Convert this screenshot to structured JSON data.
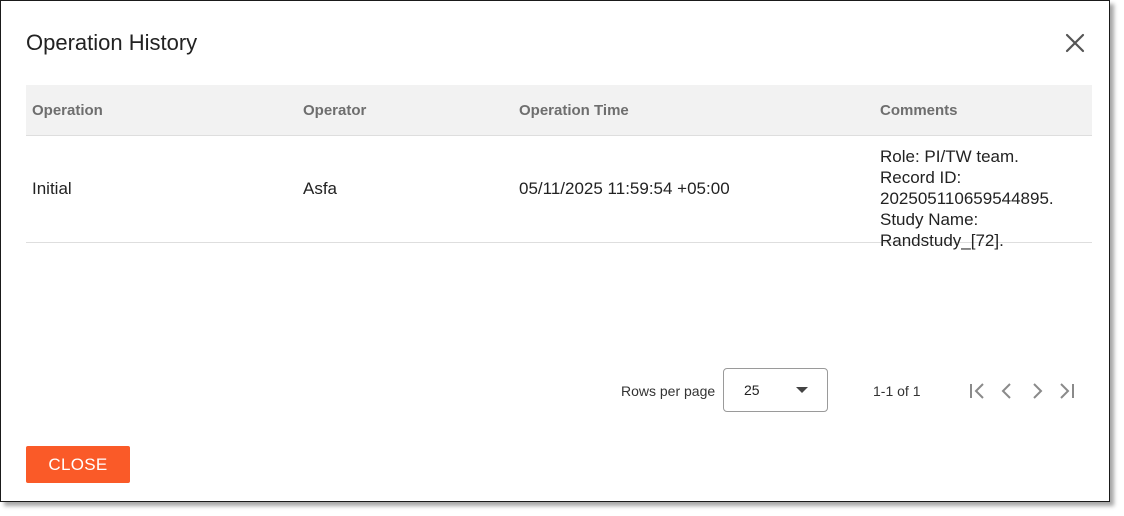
{
  "dialog": {
    "title": "Operation History",
    "close_icon": "close-icon"
  },
  "table": {
    "columns": [
      "Operation",
      "Operator",
      "Operation Time",
      "Comments"
    ],
    "rows": [
      {
        "operation": "Initial",
        "operator": "Asfa",
        "operation_time": "05/11/2025 11:59:54 +05:00",
        "comments": [
          "Role: PI/TW team.",
          "Record ID:",
          "20250511065954489​5.",
          "Study Name:",
          "Randstudy_[72]."
        ]
      }
    ]
  },
  "pagination": {
    "rows_per_page_label": "Rows per page",
    "rows_per_page_value": "25",
    "range_text": "1-1 of 1",
    "icons": [
      "first-page-icon",
      "previous-page-icon",
      "next-page-icon",
      "last-page-icon"
    ]
  },
  "footer": {
    "close_label": "CLOSE"
  },
  "colors": {
    "accent": "#fa5a28",
    "header_bg": "#f2f2f2"
  }
}
